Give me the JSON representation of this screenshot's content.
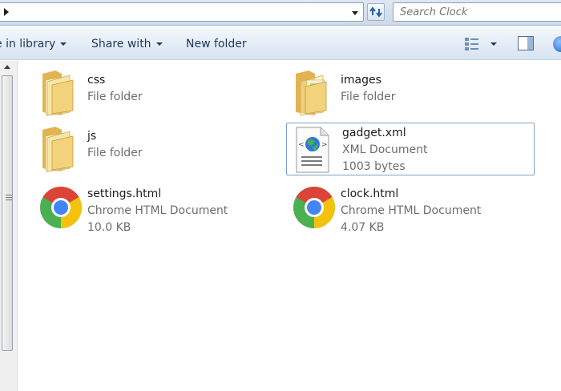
{
  "address_bar": {
    "search_placeholder": "Search Clock"
  },
  "command_bar": {
    "include_in_library_label": "e in library",
    "share_with_label": "Share with",
    "new_folder_label": "New folder"
  },
  "files": [
    {
      "name": "css",
      "type": "File folder",
      "size": ""
    },
    {
      "name": "images",
      "type": "File folder",
      "size": ""
    },
    {
      "name": "js",
      "type": "File folder",
      "size": ""
    },
    {
      "name": "gadget.xml",
      "type": "XML Document",
      "size": "1003 bytes"
    },
    {
      "name": "settings.html",
      "type": "Chrome HTML Document",
      "size": "10.0 KB"
    },
    {
      "name": "clock.html",
      "type": "Chrome HTML Document",
      "size": "4.07 KB"
    }
  ],
  "icons": {
    "folder": "folder-icon",
    "xml": "xml-document-icon",
    "chrome": "chrome-icon"
  },
  "colors": {
    "folder": "#f2d27a",
    "selection_border": "#7da2ce",
    "command_text": "#1e395b"
  }
}
